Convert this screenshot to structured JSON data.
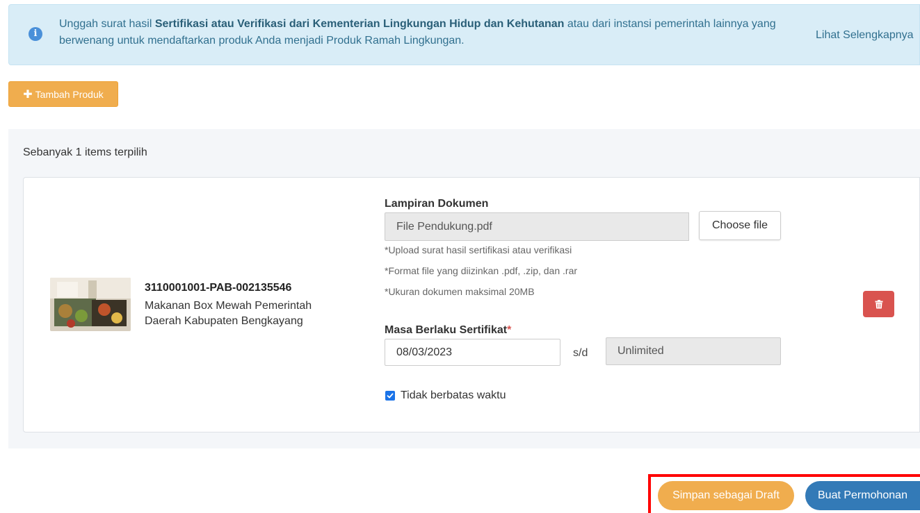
{
  "info": {
    "text_before": "Unggah surat hasil ",
    "text_bold": "Sertifikasi atau Verifikasi dari Kementerian Lingkungan Hidup dan Kehutanan",
    "text_after": " atau dari instansi pemerintah lainnya yang berwenang untuk mendaftarkan produk Anda menjadi Produk Ramah Lingkungan.",
    "link": "Lihat Selengkapnya"
  },
  "actions": {
    "add_product": "Tambah Produk"
  },
  "selection": {
    "count_text": "Sebanyak 1 items terpilih"
  },
  "product": {
    "code": "3110001001-PAB-002135546",
    "name": "Makanan Box Mewah Pemerintah Daerah Kabupaten Bengkayang"
  },
  "attachment": {
    "label": "Lampiran Dokumen",
    "file_name": "File Pendukung.pdf",
    "choose_label": "Choose file",
    "hints": [
      "*Upload surat hasil sertifikasi atau verifikasi",
      "*Format file yang diizinkan .pdf, .zip, dan .rar",
      "*Ukuran dokumen maksimal 20MB"
    ]
  },
  "validity": {
    "label": "Masa Berlaku Sertifikat",
    "required_mark": "*",
    "start_date": "08/03/2023",
    "separator": "s/d",
    "end_value": "Unlimited",
    "no_limit_label": "Tidak berbatas waktu",
    "no_limit_checked": true
  },
  "footer": {
    "draft_label": "Simpan sebagai Draft",
    "submit_label": "Buat Permohonan"
  },
  "colors": {
    "info_bg": "#d9edf7",
    "warning": "#f0ad4e",
    "danger": "#d9534f",
    "primary": "#337ab7",
    "highlight": "#ff0000"
  }
}
